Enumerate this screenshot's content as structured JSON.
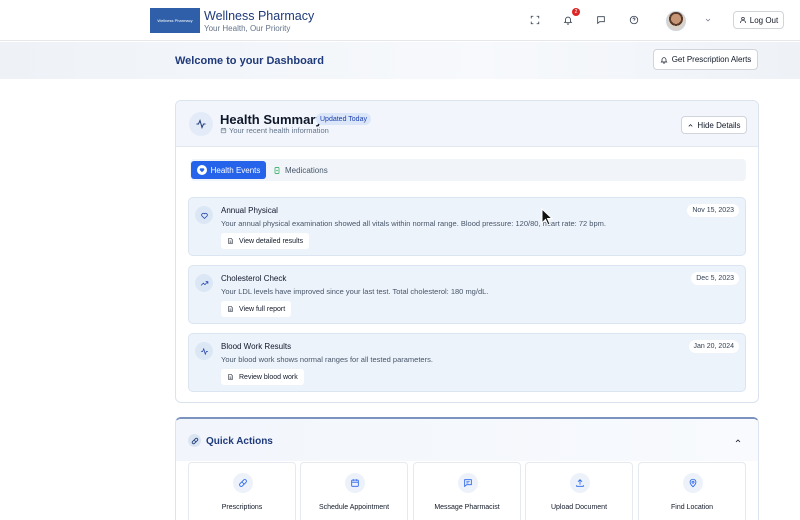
{
  "header": {
    "logo_text": "Wellness Pharmacy",
    "title": "Wellness Pharmacy",
    "subtitle": "Your Health, Our Priority",
    "notification_count": "2",
    "logout_label": "Log Out"
  },
  "welcome": {
    "title": "Welcome to your Dashboard",
    "alerts_button": "Get Prescription Alerts"
  },
  "health_summary": {
    "title": "Health Summary",
    "badge": "Updated Today",
    "subtitle": "Your recent health information",
    "hide_button": "Hide Details",
    "tabs": [
      {
        "label": "Health Events",
        "active": true
      },
      {
        "label": "Medications",
        "active": false
      }
    ],
    "events": [
      {
        "title": "Annual Physical",
        "date": "Nov 15, 2023",
        "description": "Your annual physical examination showed all vitals within normal range. Blood pressure: 120/80, heart rate: 72 bpm.",
        "link": "View detailed results",
        "icon": "heart-icon"
      },
      {
        "title": "Cholesterol Check",
        "date": "Dec 5, 2023",
        "description": "Your LDL levels have improved since your last test. Total cholesterol: 180 mg/dL.",
        "link": "View full report",
        "icon": "trending-up-icon"
      },
      {
        "title": "Blood Work Results",
        "date": "Jan 20, 2024",
        "description": "Your blood work shows normal ranges for all tested parameters.",
        "link": "Review blood work",
        "icon": "activity-icon"
      }
    ]
  },
  "quick_actions": {
    "title": "Quick Actions",
    "items": [
      {
        "label": "Prescriptions",
        "icon": "pill-icon"
      },
      {
        "label": "Schedule Appointment",
        "icon": "calendar-icon"
      },
      {
        "label": "Message Pharmacist",
        "icon": "message-icon"
      },
      {
        "label": "Upload Document",
        "icon": "upload-icon"
      },
      {
        "label": "Find Location",
        "icon": "map-pin-icon"
      }
    ]
  },
  "colors": {
    "brand": "#1f3a7a",
    "accent": "#2563eb",
    "badge_red": "#dc2626"
  }
}
